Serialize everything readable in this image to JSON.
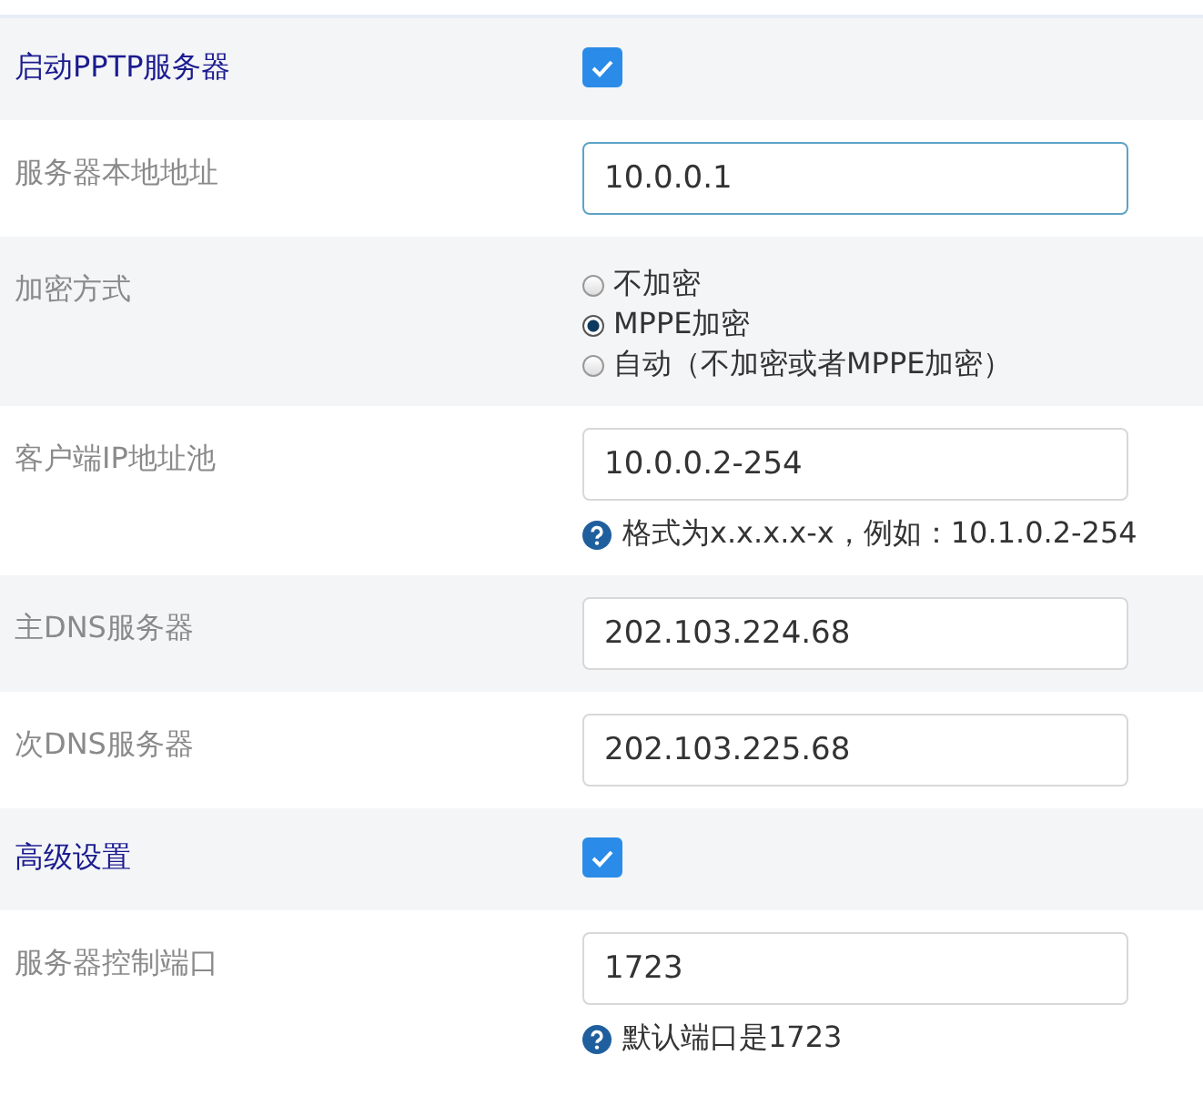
{
  "rows": [
    {
      "kind": "checkbox",
      "label": "启动PPTP服务器",
      "checked": true
    },
    {
      "kind": "input",
      "label": "服务器本地地址",
      "value": "10.0.0.1",
      "focused": true
    },
    {
      "kind": "radio",
      "label": "加密方式",
      "options": [
        {
          "label": "不加密",
          "selected": false
        },
        {
          "label": "MPPE加密",
          "selected": true
        },
        {
          "label": "自动（不加密或者MPPE加密）",
          "selected": false
        }
      ]
    },
    {
      "kind": "input",
      "label": "客户端IP地址池",
      "value": "10.0.0.2-254",
      "focused": false,
      "hint": "格式为x.x.x.x-x，例如：10.1.0.2-254"
    },
    {
      "kind": "input",
      "label": "主DNS服务器",
      "value": "202.103.224.68",
      "focused": false
    },
    {
      "kind": "input",
      "label": "次DNS服务器",
      "value": "202.103.225.68",
      "focused": false
    },
    {
      "kind": "checkbox",
      "label": "高级设置",
      "checked": true
    },
    {
      "kind": "input",
      "label": "服务器控制端口",
      "value": "1723",
      "focused": false,
      "hint": "默认端口是1723"
    }
  ]
}
